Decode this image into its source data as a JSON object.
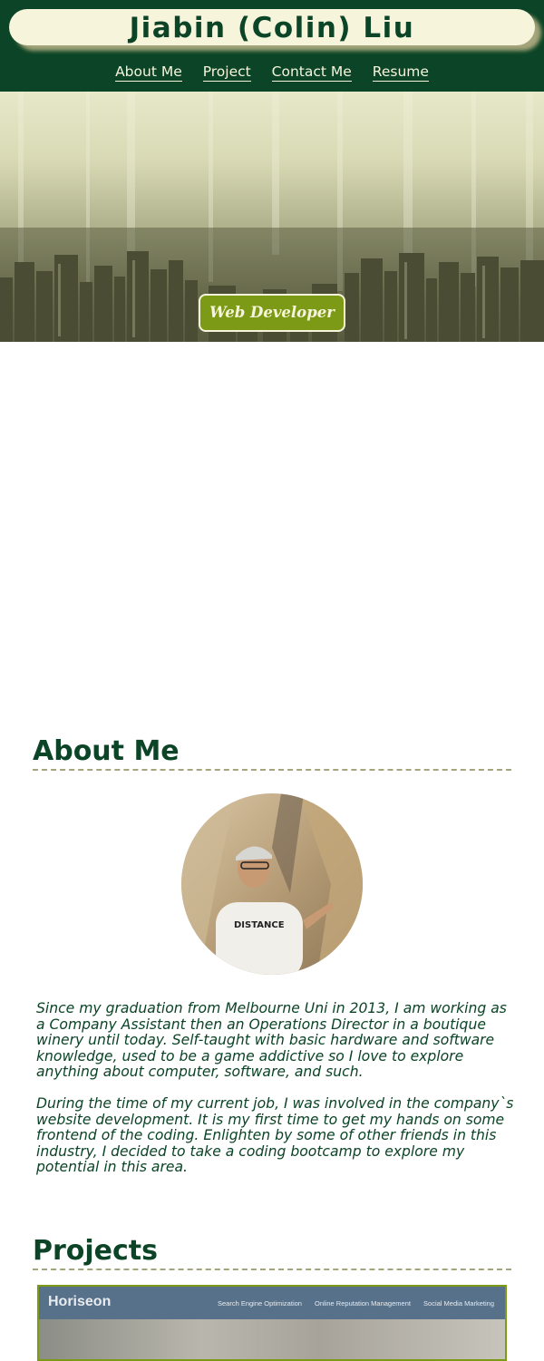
{
  "header": {
    "name": "Jiabin (Colin) Liu",
    "nav": [
      "About Me",
      "Project",
      "Contact Me",
      "Resume"
    ]
  },
  "hero": {
    "badge": "Web Developer"
  },
  "about": {
    "heading": "About Me",
    "paragraphs": [
      "Since my graduation from Melbourne Uni in 2013, I am working as a Company Assistant then an Operations Director in a boutique winery until today. Self-taught with basic hardware and software knowledge, used to be a game addictive so I love to explore anything about computer, software, and such.",
      "During the time of my current job, I was involved in the company`s website development. It is my first time to get my hands on some frontend of the coding. Enlighten by some of other friends in this industry, I decided to take a coding bootcamp to explore my potential in this area."
    ]
  },
  "projects": {
    "heading": "Projects",
    "preview": {
      "logo": "Horiseon",
      "links": [
        "Search Engine Optimization",
        "Online Reputation Management",
        "Social Media Marketing"
      ]
    }
  },
  "colors": {
    "primary": "#0b4426",
    "cream": "#f6f5dc",
    "accent": "#7d9a16",
    "divider": "#a4a57a"
  }
}
